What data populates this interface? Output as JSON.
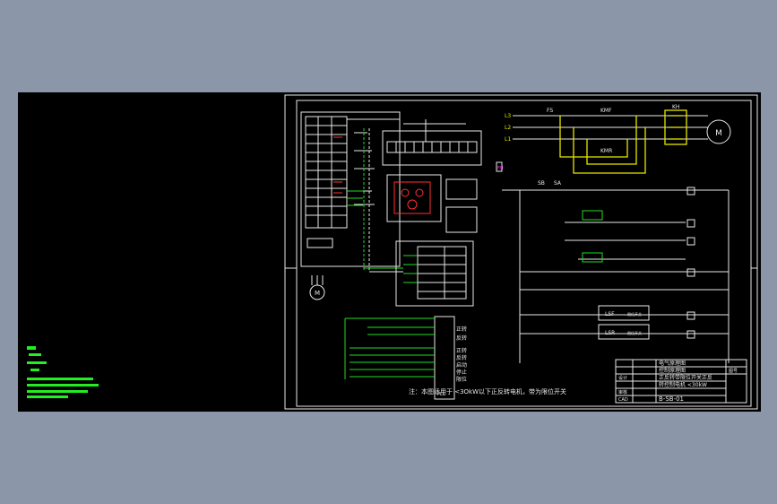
{
  "colors": {
    "background": "#8b97a9",
    "viewport": "#000000",
    "line_white": "#e8e8e8",
    "line_yellow": "#e6e600",
    "line_green": "#22dd22",
    "label_magenta": "#ff33ff",
    "label_green": "#22ee22"
  },
  "plc": {
    "title": "PLC",
    "output_labels": [
      "正转",
      "反转",
      "正转",
      "反转",
      "启动",
      "停止",
      "限位"
    ]
  },
  "power": {
    "phases": [
      "L3",
      "L2",
      "L1"
    ],
    "fuse": "FS",
    "kmf": "KMF",
    "kmr": "KMR",
    "kh": "KH",
    "motor": "M",
    "fu": "FU"
  },
  "control": {
    "sb": "SB",
    "sa": "SA",
    "lsf": "LSF",
    "lsr": "LSR",
    "limit_text": "限位开关"
  },
  "note": "注：本图适用于 <3OkW以下正反转电机，带为限位开关",
  "title_block": {
    "name1": "电气原理图",
    "name2": "控制原理图",
    "desc1": "正反转带限位开关正反",
    "desc2": "转控制电机 <30kW",
    "code": "B-SB-01",
    "row_labels": [
      "设计",
      "审核",
      "CAD"
    ],
    "right_label": "图号"
  },
  "motor_small": "M"
}
